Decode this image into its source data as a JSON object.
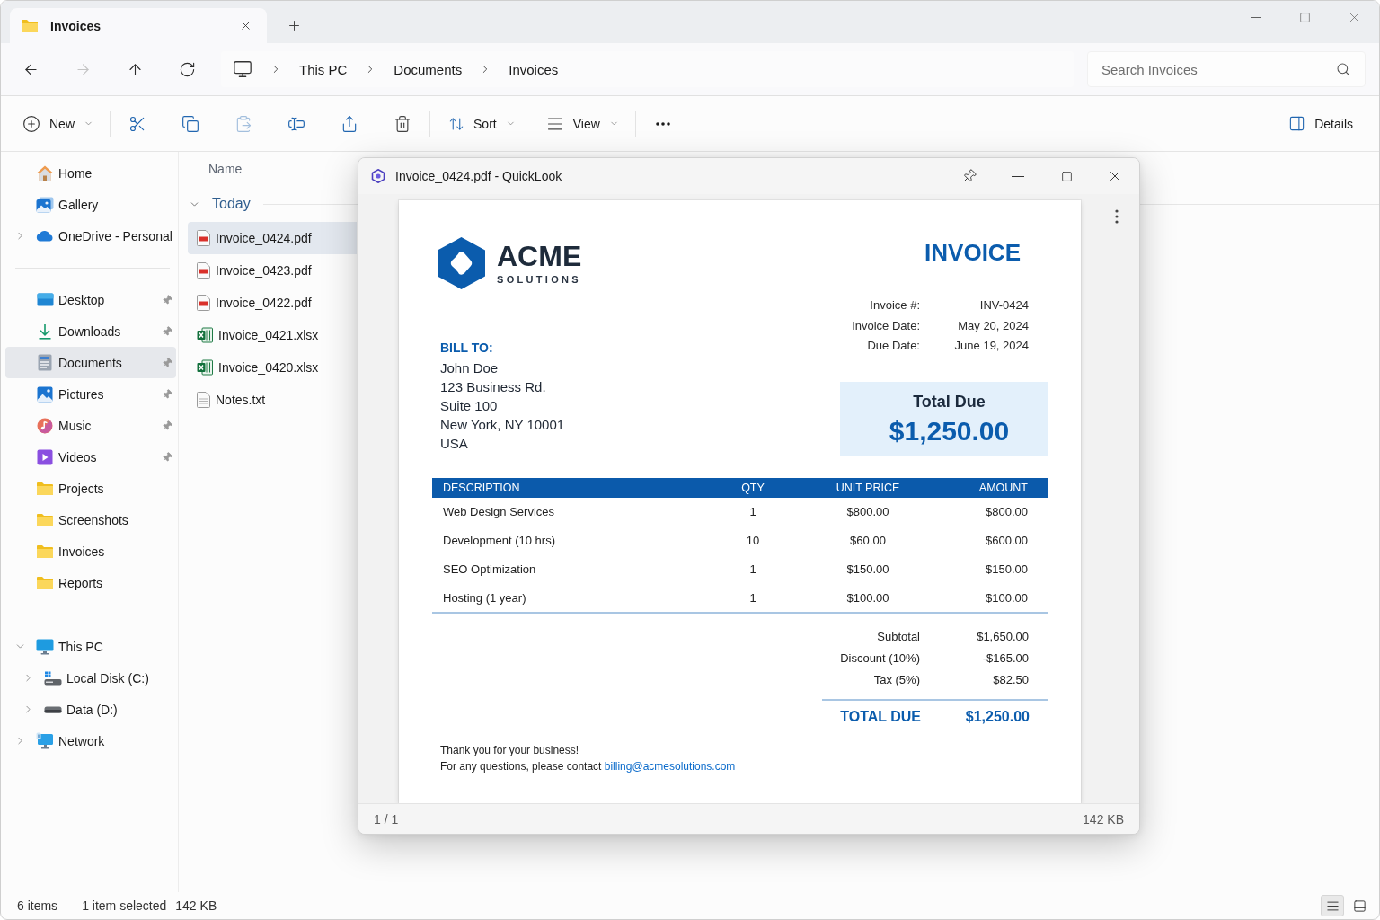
{
  "tabs": [
    {
      "label": "Invoices",
      "selected": true
    }
  ],
  "navigation": [
    {
      "kind": "back",
      "disabled": false
    },
    {
      "kind": "forward",
      "disabled": true
    },
    {
      "kind": "up",
      "disabled": false
    },
    {
      "kind": "refresh",
      "disabled": false
    }
  ],
  "address_bar": {
    "breadcrumbs": [
      "This PC",
      "Documents",
      "Invoices"
    ]
  },
  "search": {
    "placeholder": "Search Invoices"
  },
  "command_bar": {
    "groups": [
      {
        "items": [
          {
            "kind": "new",
            "label": "New",
            "dropdown": true,
            "disabled": false
          }
        ]
      },
      {
        "items": [
          {
            "kind": "cut",
            "dropdown": false,
            "disabled": false
          },
          {
            "kind": "copy",
            "dropdown": false,
            "disabled": false
          },
          {
            "kind": "paste",
            "dropdown": false,
            "disabled": true
          },
          {
            "kind": "rename",
            "dropdown": false,
            "disabled": false
          },
          {
            "kind": "share",
            "dropdown": false,
            "disabled": false
          },
          {
            "kind": "delete",
            "dropdown": false,
            "disabled": false
          }
        ]
      },
      {
        "items": [
          {
            "kind": "sort",
            "label": "Sort",
            "dropdown": true,
            "disabled": false
          },
          {
            "kind": "view",
            "label": "View",
            "dropdown": true,
            "disabled": false
          }
        ]
      },
      {
        "items": [
          {
            "kind": "more",
            "dropdown": false,
            "disabled": false
          }
        ]
      }
    ],
    "details": {
      "label": "Details"
    }
  },
  "sidebar": {
    "sections": [
      {
        "items": [
          {
            "label": "Home",
            "kind": "home",
            "selected": false
          },
          {
            "label": "Gallery",
            "kind": "gallery",
            "selected": false
          },
          {
            "label": "OneDrive - Personal",
            "kind": "cloud",
            "selected": false,
            "expanded": false
          }
        ]
      },
      {
        "items": [
          {
            "label": "Desktop",
            "kind": "desktop",
            "pinned": true,
            "selected": false
          },
          {
            "label": "Downloads",
            "kind": "downloads",
            "pinned": true,
            "selected": false
          },
          {
            "label": "Documents",
            "kind": "documents",
            "pinned": true,
            "selected": true
          },
          {
            "label": "Pictures",
            "kind": "pictures",
            "pinned": true,
            "selected": false
          },
          {
            "label": "Music",
            "kind": "music",
            "pinned": true,
            "selected": false
          },
          {
            "label": "Videos",
            "kind": "videos",
            "pinned": true,
            "selected": false
          },
          {
            "label": "Projects",
            "kind": "folder",
            "pinned": false,
            "selected": false
          },
          {
            "label": "Screenshots",
            "kind": "folder",
            "pinned": false,
            "selected": false
          },
          {
            "label": "Invoices",
            "kind": "folder",
            "pinned": false,
            "selected": false
          },
          {
            "label": "Reports",
            "kind": "folder",
            "pinned": false,
            "selected": false
          }
        ]
      },
      {
        "items": [
          {
            "label": "This PC",
            "kind": "pc",
            "selected": false,
            "expanded": true,
            "children": [
              {
                "label": "Local Disk (C:)",
                "kind": "system_disk",
                "selected": false,
                "expanded": false
              },
              {
                "label": "Data (D:)",
                "kind": "disk",
                "selected": false,
                "expanded": false
              }
            ]
          },
          {
            "label": "Network",
            "kind": "network",
            "selected": false,
            "expanded": false
          }
        ]
      }
    ]
  },
  "file_list": {
    "column_header": "Name",
    "groups": [
      {
        "label": "Today",
        "expanded": true,
        "files": [
          {
            "name": "Invoice_0424.pdf",
            "kind": "pdf",
            "selected": true
          },
          {
            "name": "Invoice_0423.pdf",
            "kind": "pdf",
            "selected": false
          },
          {
            "name": "Invoice_0422.pdf",
            "kind": "pdf",
            "selected": false
          },
          {
            "name": "Invoice_0421.xlsx",
            "kind": "xlsx",
            "selected": false
          },
          {
            "name": "Invoice_0420.xlsx",
            "kind": "xlsx",
            "selected": false
          },
          {
            "name": "Notes.txt",
            "kind": "txt",
            "selected": false
          }
        ]
      }
    ]
  },
  "status_bar": {
    "item_count": "6 items",
    "selection": "1 item selected",
    "size": "142 KB",
    "views": [
      {
        "kind": "details",
        "selected": true
      },
      {
        "kind": "tiles",
        "selected": false
      }
    ]
  },
  "quicklook": {
    "title": "Invoice_0424.pdf - QuickLook",
    "page_indicator": "1 / 1",
    "file_size": "142 KB",
    "document": {
      "company": {
        "name": "ACME",
        "tagline": "SOLUTIONS"
      },
      "heading": "INVOICE",
      "meta": [
        {
          "label": "Invoice #:",
          "value": "INV-0424"
        },
        {
          "label": "Invoice Date:",
          "value": "May 20, 2024"
        },
        {
          "label": "Due Date:",
          "value": "June 19, 2024"
        }
      ],
      "bill_to": {
        "heading": "BILL TO:",
        "lines": [
          "John Doe",
          "123 Business Rd.",
          "Suite 100",
          "New York, NY 10001",
          "USA"
        ]
      },
      "total_box": {
        "label": "Total Due",
        "amount": "$1,250.00"
      },
      "line_items": {
        "columns": [
          "DESCRIPTION",
          "QTY",
          "UNIT PRICE",
          "AMOUNT"
        ],
        "rows": [
          [
            "Web Design Services",
            "1",
            "$800.00",
            "$800.00"
          ],
          [
            "Development (10 hrs)",
            "10",
            "$60.00",
            "$600.00"
          ],
          [
            "SEO Optimization",
            "1",
            "$150.00",
            "$150.00"
          ],
          [
            "Hosting (1 year)",
            "1",
            "$100.00",
            "$100.00"
          ]
        ]
      },
      "summary": [
        {
          "label": "Subtotal",
          "value": "$1,650.00"
        },
        {
          "label": "Discount (10%)",
          "value": "-$165.00"
        },
        {
          "label": "Tax (5%)",
          "value": "$82.50"
        }
      ],
      "grand_total": {
        "label": "TOTAL DUE",
        "value": "$1,250.00"
      },
      "footer": {
        "thanks": "Thank you for your business!",
        "contact": "For any questions, please contact",
        "email": "billing@acmesolutions.com"
      }
    }
  }
}
